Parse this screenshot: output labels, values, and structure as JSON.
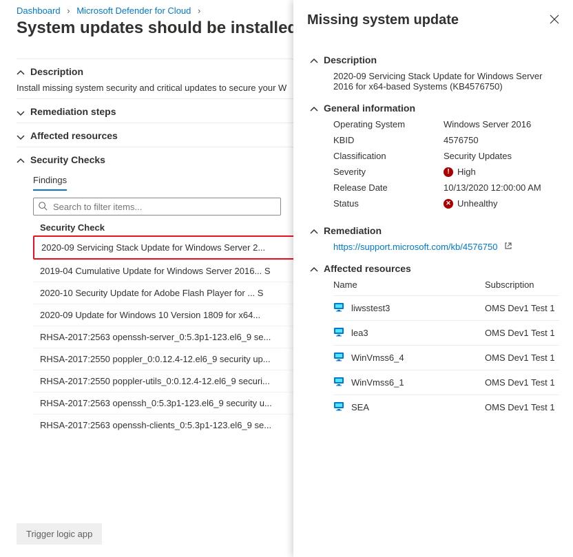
{
  "breadcrumb": {
    "items": [
      "Dashboard",
      "Microsoft Defender for Cloud"
    ]
  },
  "page_title": "System updates should be installed",
  "sections": {
    "description": {
      "label": "Description",
      "body": "Install missing system security and critical updates to secure your W"
    },
    "remediation": {
      "label": "Remediation steps"
    },
    "affected": {
      "label": "Affected resources"
    },
    "security_checks": {
      "label": "Security Checks"
    }
  },
  "findings_label": "Findings",
  "search": {
    "placeholder": "Search to filter items..."
  },
  "list_header": {
    "col1": "Security Check"
  },
  "findings": [
    {
      "label": "2020-09 Servicing Stack Update for Windows Server 2...",
      "selected": true
    },
    {
      "label": "2019-04 Cumulative Update for Windows Server 2016...   S"
    },
    {
      "label": "2020-10 Security Update for Adobe Flash Player for ...   S"
    },
    {
      "label": "2020-09 Update for Windows 10 Version 1809 for x64..."
    },
    {
      "label": "RHSA-2017:2563 openssh-server_0:5.3p1-123.el6_9 se..."
    },
    {
      "label": "RHSA-2017:2550 poppler_0:0.12.4-12.el6_9 security up..."
    },
    {
      "label": "RHSA-2017:2550 poppler-utils_0:0.12.4-12.el6_9 securi..."
    },
    {
      "label": "RHSA-2017:2563 openssh_0:5.3p1-123.el6_9 security u..."
    },
    {
      "label": "RHSA-2017:2563 openssh-clients_0:5.3p1-123.el6_9 se..."
    }
  ],
  "trigger_button": "Trigger logic app",
  "flyout": {
    "title": "Missing system update",
    "description": {
      "label": "Description",
      "body": "2020-09 Servicing Stack Update for  Windows Server 2016 for x64-based Systems  (KB4576750)"
    },
    "general": {
      "label": "General information",
      "rows": [
        {
          "k": "Operating System",
          "v": "Windows Server 2016"
        },
        {
          "k": "KBID",
          "v": "4576750"
        },
        {
          "k": "Classification",
          "v": "Security Updates"
        },
        {
          "k": "Severity",
          "v": "High",
          "badge": "high"
        },
        {
          "k": "Release Date",
          "v": "10/13/2020 12:00:00 AM"
        },
        {
          "k": "Status",
          "v": "Unhealthy",
          "badge": "x"
        }
      ]
    },
    "remediation": {
      "label": "Remediation",
      "link": "https://support.microsoft.com/kb/4576750"
    },
    "resources": {
      "label": "Affected resources",
      "header": {
        "name": "Name",
        "sub": "Subscription"
      },
      "rows": [
        {
          "name": "liwsstest3",
          "sub": "OMS Dev1 Test 1"
        },
        {
          "name": "lea3",
          "sub": "OMS Dev1 Test 1"
        },
        {
          "name": "WinVmss6_4",
          "sub": "OMS Dev1 Test 1"
        },
        {
          "name": "WinVmss6_1",
          "sub": "OMS Dev1 Test 1"
        },
        {
          "name": "SEA",
          "sub": "OMS Dev1 Test 1"
        }
      ]
    }
  }
}
